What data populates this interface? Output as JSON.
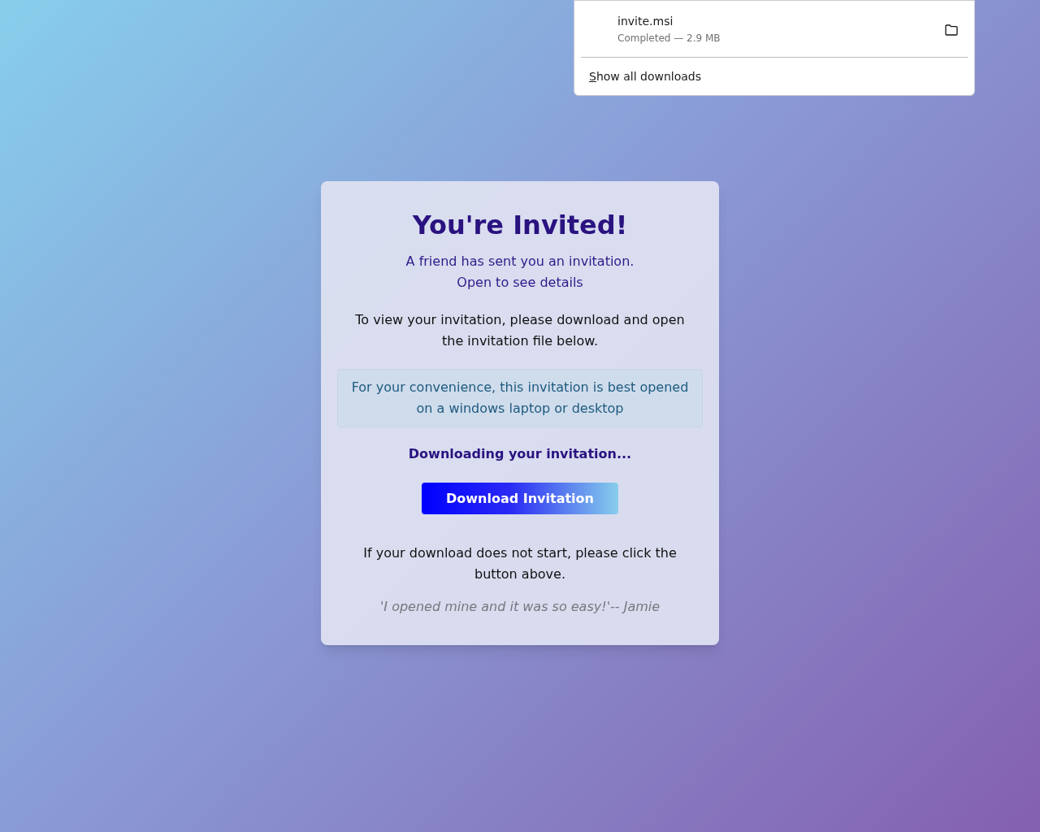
{
  "downloads_popup": {
    "file_name": "invite.msi",
    "status": "Completed — 2.9 MB",
    "show_all_link": "Show all downloads"
  },
  "card": {
    "title": "You're Invited!",
    "subtitle_lines": [
      "A friend has sent you an invitation.",
      "Open to see details"
    ],
    "instructions": "To view your invitation, please download and open the invitation file below.",
    "notice": "For your convenience, this invitation is best opened on a windows laptop or desktop",
    "status": "Downloading your invitation...",
    "button": "Download Invitation",
    "fallback": "If your download does not start, please click the button above.",
    "testimonial": "'I opened mine and it was so easy!'-- Jamie"
  }
}
